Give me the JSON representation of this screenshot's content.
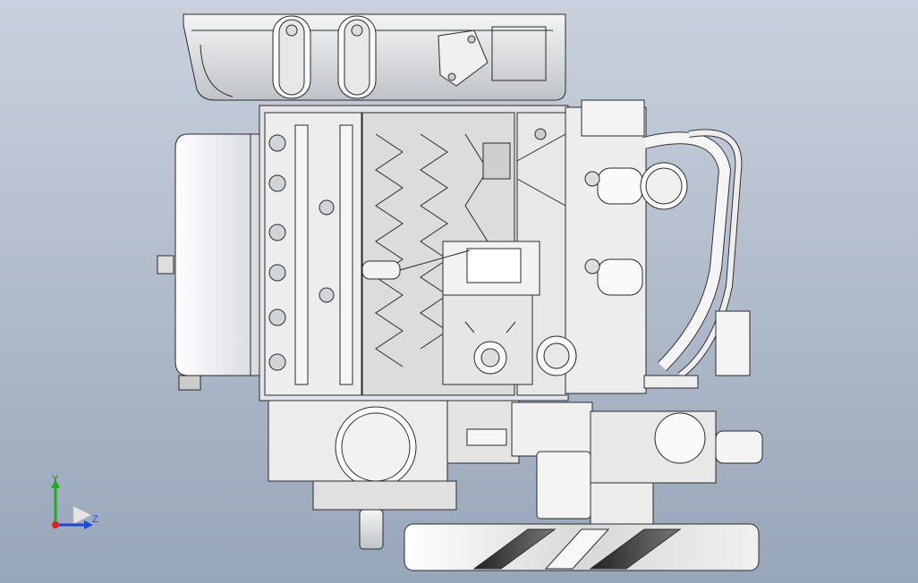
{
  "viewport": {
    "background_top": "#c9d1dd",
    "background_bottom": "#98a6ba",
    "model": "engine-assembly"
  },
  "triad": {
    "y_label": "Y",
    "z_label": "Z",
    "y_color": "#22aa22",
    "z_color": "#2244dd",
    "x_color": "#dd2222"
  },
  "colors": {
    "part_fill": "#ffffff",
    "part_shade": "#d9dde3",
    "edge": "#2a2a2a",
    "dark_shade": "#4a4a4a"
  }
}
